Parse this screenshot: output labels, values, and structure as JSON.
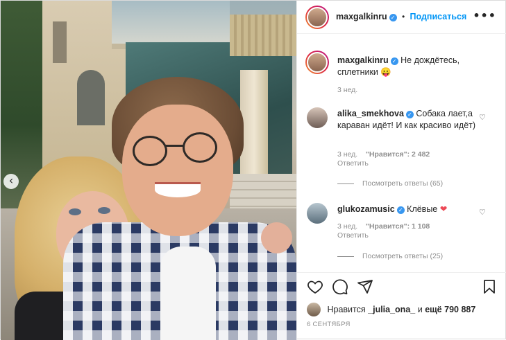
{
  "header": {
    "username": "maxgalkinru",
    "separator": "•",
    "follow_label": "Подписаться",
    "more_icon": "•••"
  },
  "caption": {
    "username": "maxgalkinru",
    "text": "Не дождётесь, сплетники",
    "emoji": "😛",
    "time": "3 нед."
  },
  "comments": [
    {
      "username": "alika_smekhova",
      "text": "Собака лает,а караван идёт! И как красиво идёт)",
      "time": "3 нед.",
      "likes": "\"Нравится\": 2 482",
      "reply_label": "Ответить",
      "view_replies": "Посмотреть ответы (65)"
    },
    {
      "username": "glukozamusic",
      "text": "Клёвые",
      "emoji": "❤",
      "time": "3 нед.",
      "likes": "\"Нравится\": 1 108",
      "reply_label": "Ответить",
      "view_replies": "Посмотреть ответы (25)"
    }
  ],
  "liked_by": {
    "prefix": "Нравится",
    "user": "_julia_ona_",
    "joiner": "и",
    "others": "ещё 790 887"
  },
  "date": "6 СЕНТЯБРЯ",
  "icons": {
    "prev": "‹",
    "verified": "✓",
    "heart": "♡"
  },
  "colors": {
    "accent": "#0095f6",
    "verified": "#3897f0",
    "muted": "#8e8e8e",
    "like_red": "#ed4956"
  }
}
